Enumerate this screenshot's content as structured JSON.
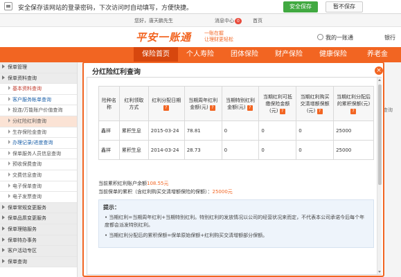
{
  "password_bar": {
    "message": "安全保存该网站的登录密码，下次访问时自动填写，方便快捷。",
    "save_label": "安全保存",
    "nosave_label": "暂不保存"
  },
  "info_bar": {
    "greeting": "您好，唐天鹏先生",
    "message_center": "消息中心",
    "message_count": "0",
    "home": "首页"
  },
  "header": {
    "logo_text": "平安一账通",
    "slogan_line1": "一账在握",
    "slogan_line2": "让理财更轻松",
    "my_account": "我的一账通",
    "bank": "银行"
  },
  "nav": {
    "items": [
      "保险首页",
      "个人寿险",
      "团体保险",
      "财产保险",
      "健康保险",
      "养老金"
    ]
  },
  "sidebar": {
    "items": [
      {
        "label": "保单管理",
        "type": "group"
      },
      {
        "label": "保单资料查询",
        "type": "group"
      },
      {
        "label": "基本资料查询",
        "type": "sub",
        "style": "hl"
      },
      {
        "label": "客户服务帐单查询",
        "type": "sub",
        "style": "blue"
      },
      {
        "label": "投连/万能账户价值查询",
        "type": "sub",
        "style": ""
      },
      {
        "label": "分红险红利查询",
        "type": "sub",
        "style": "sel"
      },
      {
        "label": "生存保险金查询",
        "type": "sub",
        "style": ""
      },
      {
        "label": "办理记录/进度查询",
        "type": "sub",
        "style": "blue"
      },
      {
        "label": "保单服务人员信息查询",
        "type": "sub",
        "style": ""
      },
      {
        "label": "预收保费查询",
        "type": "sub",
        "style": ""
      },
      {
        "label": "交费信息查询",
        "type": "sub",
        "style": ""
      },
      {
        "label": "电子保单查询",
        "type": "sub",
        "style": ""
      },
      {
        "label": "电子发票查询",
        "type": "sub",
        "style": ""
      },
      {
        "label": "保单常规变更服务",
        "type": "group"
      },
      {
        "label": "保单品质变更服务",
        "type": "group"
      },
      {
        "label": "保单理赔服务",
        "type": "group"
      },
      {
        "label": "保单特办事务",
        "type": "group"
      },
      {
        "label": "客户活动专区",
        "type": "group"
      },
      {
        "label": "保单查询",
        "type": "group"
      }
    ]
  },
  "dialog": {
    "title": "分红险红利查询",
    "close": "×",
    "table": {
      "headers": [
        "险种名称",
        "红利领取方式",
        "红利分配日期",
        "当期周年红利金额(元)",
        "当期特别红利金额(元)",
        "当期红利可抵缴保险金额(元)",
        "当期红利购买交清增额保额(元)",
        "当期红利分配后的累积保额(元)"
      ],
      "rows": [
        [
          "鑫祥",
          "累积生息",
          "2015-03-24",
          "78.81",
          "0",
          "0",
          "0",
          "25000"
        ],
        [
          "鑫祥",
          "累积生息",
          "2014-03-24",
          "28.73",
          "0",
          "0",
          "0",
          "25000"
        ]
      ]
    },
    "summary": {
      "balance_label": "当前累积红利账户余额",
      "balance_value": "108.55元",
      "sum_label": "当前保单的累积（含红利购买交清增额保险的保额）：",
      "sum_value": "25000元"
    },
    "tips": {
      "heading": "提示：",
      "line1": "• 当期红利=当期周年红利+当期特别红利。特别红利的发放情况以公司的经营状况来而定，不代表本公司承诺今后每个年度都会派发特别红利。",
      "line2": "• 当期红利分配后的累积保额=保单原始保额+红利购买交清增额部分保额。"
    }
  },
  "background": {
    "hint": "查询"
  }
}
